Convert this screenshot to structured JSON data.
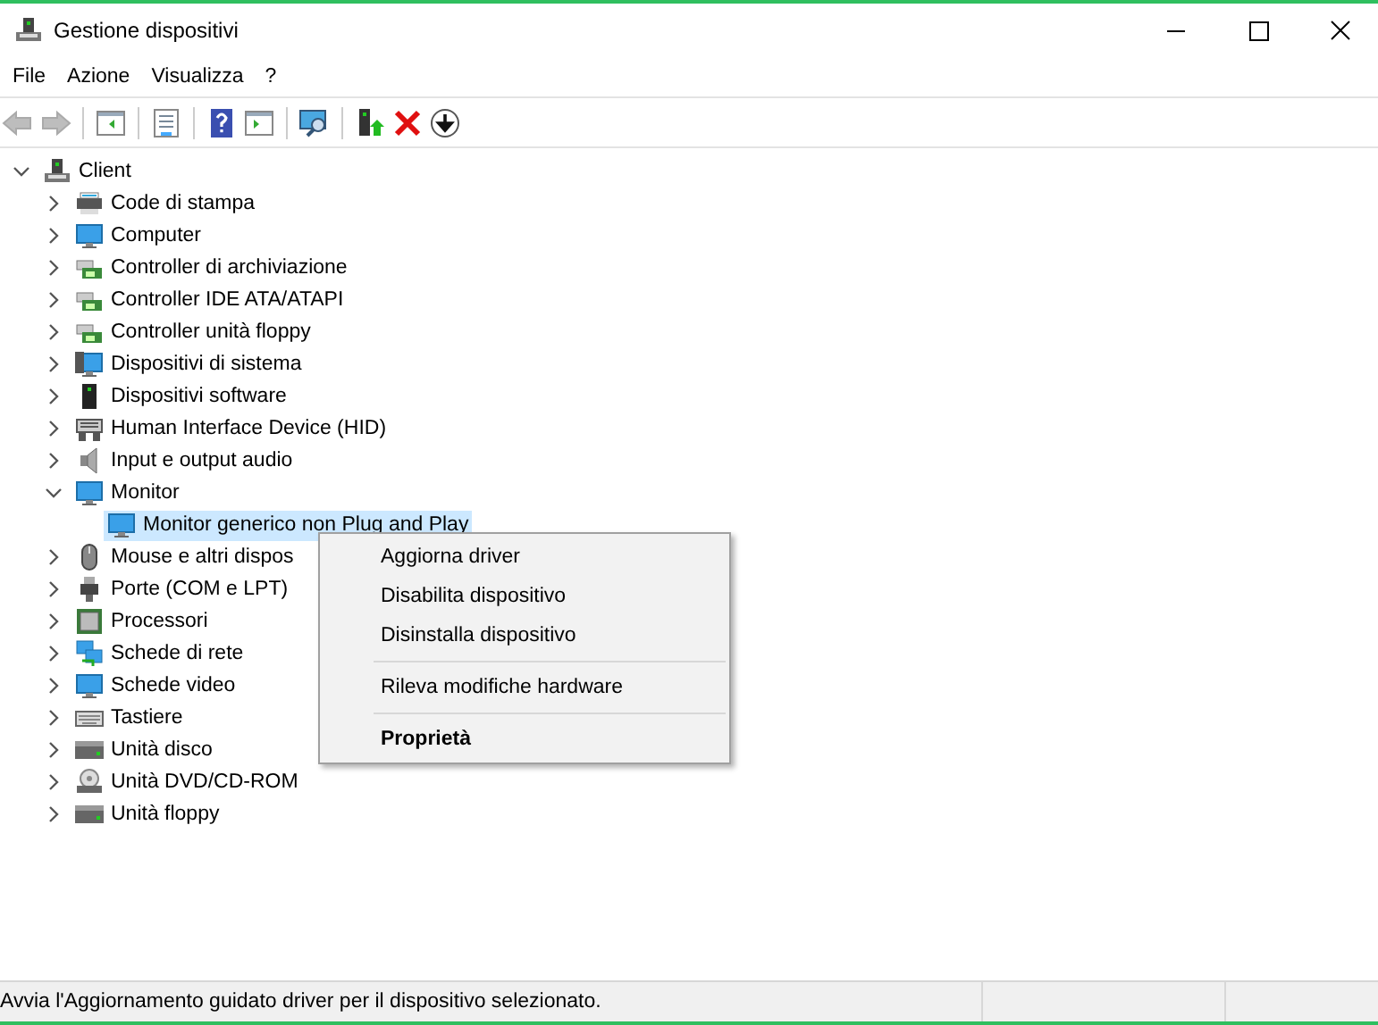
{
  "window": {
    "title": "Gestione dispositivi"
  },
  "menu": [
    "File",
    "Azione",
    "Visualizza",
    "?"
  ],
  "toolbar": [
    {
      "kind": "back",
      "disabled": true
    },
    {
      "kind": "forward",
      "disabled": true
    },
    {
      "kind": "sep"
    },
    {
      "kind": "tree"
    },
    {
      "kind": "sep"
    },
    {
      "kind": "props"
    },
    {
      "kind": "sep"
    },
    {
      "kind": "help"
    },
    {
      "kind": "pane"
    },
    {
      "kind": "sep"
    },
    {
      "kind": "scan"
    },
    {
      "kind": "sep"
    },
    {
      "kind": "update"
    },
    {
      "kind": "remove"
    },
    {
      "kind": "disable"
    }
  ],
  "tree": {
    "label": "Client",
    "kind": "computer",
    "expanded": true,
    "selected": false,
    "children": [
      {
        "label": "Code di stampa",
        "kind": "printer",
        "expanded": false,
        "selected": false
      },
      {
        "label": "Computer",
        "kind": "monitor",
        "expanded": false,
        "selected": false
      },
      {
        "label": "Controller di archiviazione",
        "kind": "card",
        "expanded": false,
        "selected": false
      },
      {
        "label": "Controller IDE ATA/ATAPI",
        "kind": "card",
        "expanded": false,
        "selected": false
      },
      {
        "label": "Controller unità floppy",
        "kind": "card",
        "expanded": false,
        "selected": false
      },
      {
        "label": "Dispositivi di sistema",
        "kind": "system",
        "expanded": false,
        "selected": false
      },
      {
        "label": "Dispositivi software",
        "kind": "tower",
        "expanded": false,
        "selected": false
      },
      {
        "label": "Human Interface Device (HID)",
        "kind": "hid",
        "expanded": false,
        "selected": false
      },
      {
        "label": "Input e output audio",
        "kind": "speaker",
        "expanded": false,
        "selected": false
      },
      {
        "label": "Monitor",
        "kind": "monitor",
        "expanded": true,
        "selected": false,
        "children": [
          {
            "label": "Monitor generico non Plug and Play",
            "kind": "monitor",
            "selected": true
          }
        ]
      },
      {
        "label": "Mouse e altri dispos",
        "kind": "mouse",
        "expanded": false,
        "selected": false
      },
      {
        "label": "Porte (COM e LPT)",
        "kind": "port",
        "expanded": false,
        "selected": false
      },
      {
        "label": "Processori",
        "kind": "cpu",
        "expanded": false,
        "selected": false
      },
      {
        "label": "Schede di rete",
        "kind": "network",
        "expanded": false,
        "selected": false
      },
      {
        "label": "Schede video",
        "kind": "monitor",
        "expanded": false,
        "selected": false
      },
      {
        "label": "Tastiere",
        "kind": "keyboard",
        "expanded": false,
        "selected": false
      },
      {
        "label": "Unità disco",
        "kind": "disk",
        "expanded": false,
        "selected": false
      },
      {
        "label": "Unità DVD/CD-ROM",
        "kind": "dvd",
        "expanded": false,
        "selected": false
      },
      {
        "label": "Unità floppy",
        "kind": "disk",
        "expanded": false,
        "selected": false
      }
    ]
  },
  "context_menu": [
    {
      "label": "Aggiorna driver",
      "kind": "item"
    },
    {
      "label": "Disabilita dispositivo",
      "kind": "item"
    },
    {
      "label": "Disinstalla dispositivo",
      "kind": "item"
    },
    {
      "kind": "separator"
    },
    {
      "label": "Rileva modifiche hardware",
      "kind": "item"
    },
    {
      "kind": "separator"
    },
    {
      "label": "Proprietà",
      "kind": "default"
    }
  ],
  "status_bar": {
    "text": "Avvia l'Aggiornamento guidato driver per il dispositivo selezionato."
  }
}
